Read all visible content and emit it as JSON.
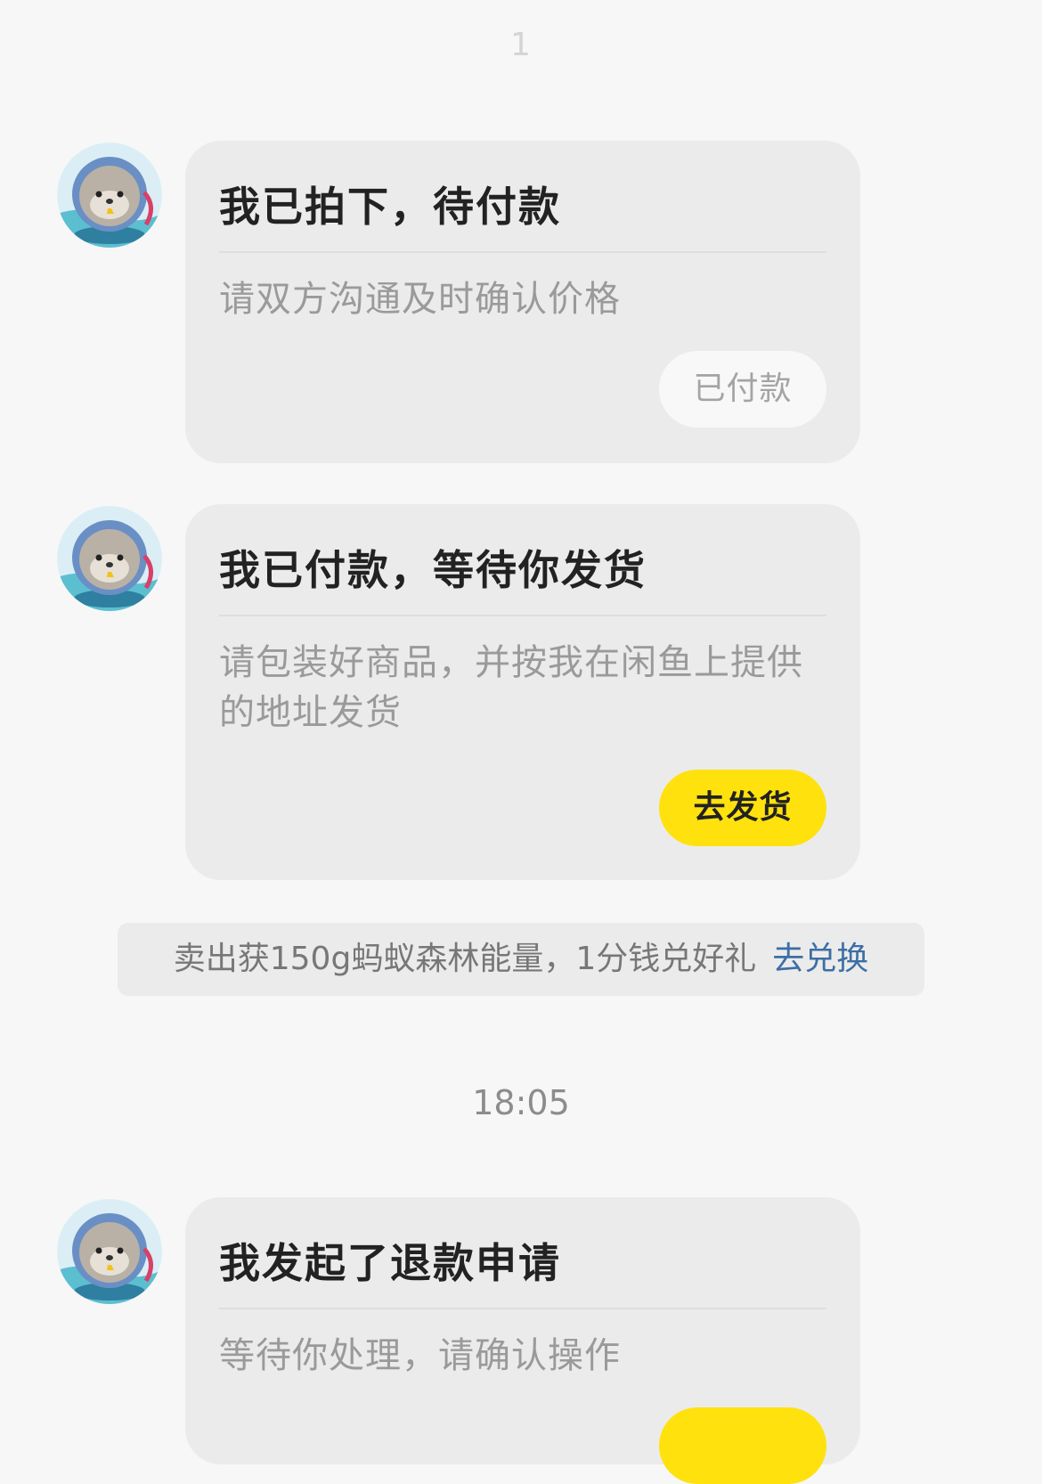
{
  "top_time": "1",
  "messages": [
    {
      "title": "我已拍下，待付款",
      "body": "请双方沟通及时确认价格",
      "button": "已付款"
    },
    {
      "title": "我已付款，等待你发货",
      "body": "请包装好商品，并按我在闲鱼上提供的地址发货",
      "button": "去发货"
    },
    {
      "title": "我发起了退款申请",
      "body": "等待你处理，请确认操作"
    }
  ],
  "notice": {
    "text": "卖出获150g蚂蚁森林能量，1分钱兑好礼",
    "link": "去兑换"
  },
  "time_separator": "18:05",
  "colors": {
    "accent_yellow": "#ffe10e",
    "link_blue": "#3d6ea6",
    "card_bg": "#ebebeb"
  },
  "avatar_icon": "seal-avatar-icon"
}
